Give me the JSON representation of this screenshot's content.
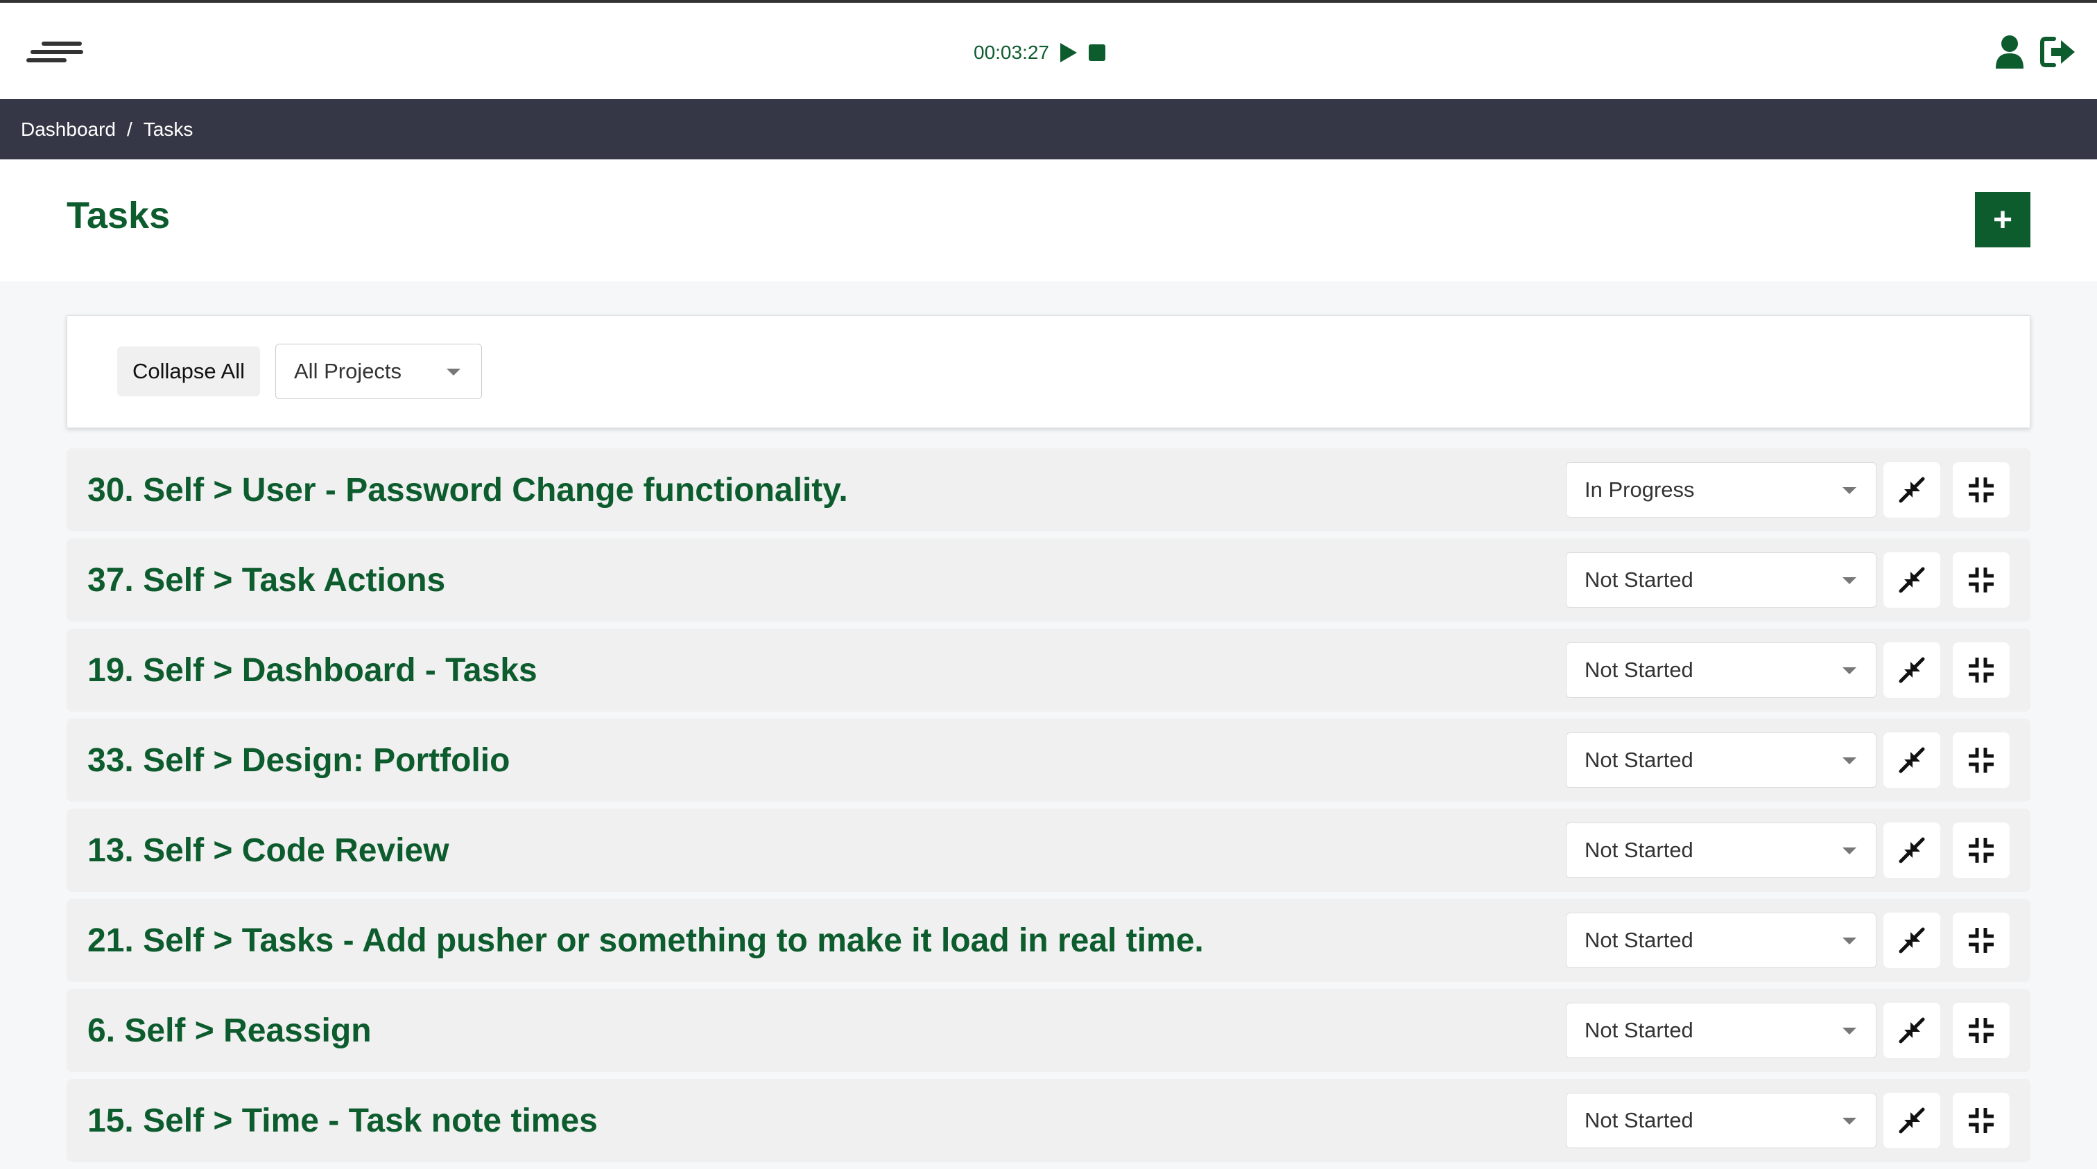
{
  "timer": {
    "elapsed": "00:03:27"
  },
  "breadcrumb": {
    "items": [
      "Dashboard",
      "Tasks"
    ],
    "separator": "/"
  },
  "page": {
    "title": "Tasks",
    "add_label": "+"
  },
  "filters": {
    "collapse_label": "Collapse All",
    "project_value": "All Projects"
  },
  "tasks": [
    {
      "title": "30. Self > User - Password Change functionality.",
      "status": "In Progress"
    },
    {
      "title": "37. Self > Task Actions",
      "status": "Not Started"
    },
    {
      "title": "19. Self > Dashboard - Tasks",
      "status": "Not Started"
    },
    {
      "title": "33. Self > Design: Portfolio",
      "status": "Not Started"
    },
    {
      "title": "13. Self > Code Review",
      "status": "Not Started"
    },
    {
      "title": "21. Self > Tasks - Add pusher or something to make it load in real time.",
      "status": "Not Started"
    },
    {
      "title": "6. Self > Reassign",
      "status": "Not Started"
    },
    {
      "title": "15. Self > Time - Task note times",
      "status": "Not Started"
    }
  ],
  "colors": {
    "brand_green": "#0d5c2e",
    "breadcrumb_bg": "#353746",
    "row_bg": "#f0f0f0"
  },
  "icons": {
    "menu": "hamburger-menu-icon",
    "play": "play-icon",
    "stop": "stop-icon",
    "user": "user-icon",
    "logout": "sign-out-icon",
    "row_minimize": "compress-arrows-icon",
    "row_collapse": "collapse-icon"
  }
}
